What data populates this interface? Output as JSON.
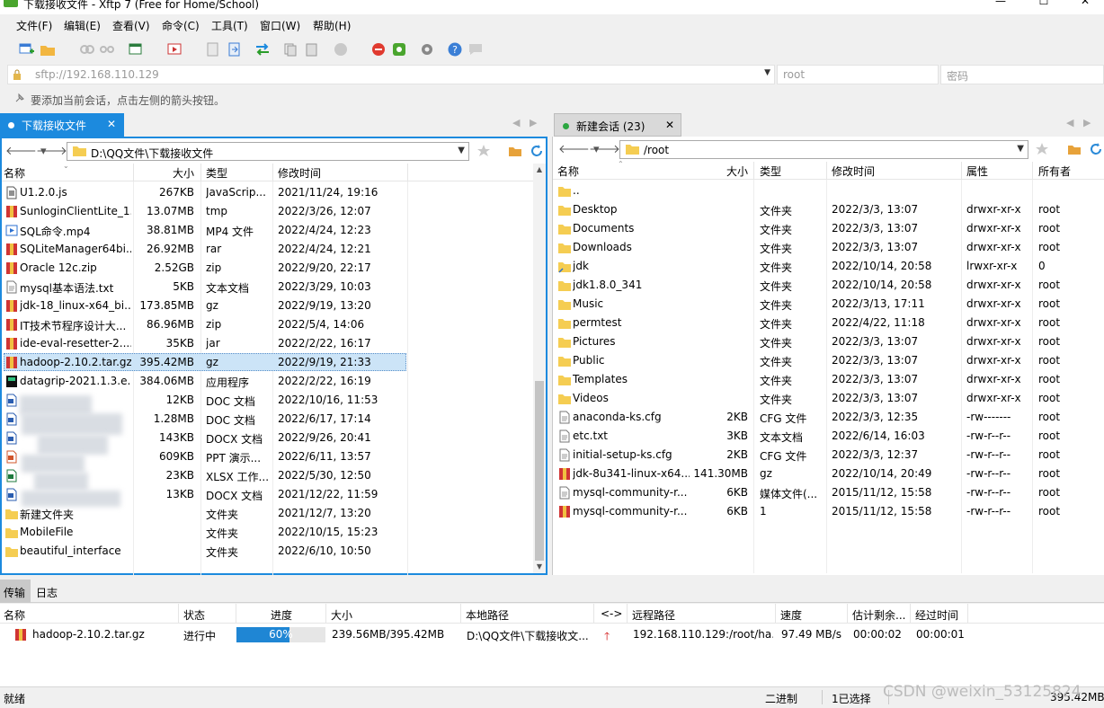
{
  "window": {
    "title": "下载接收文件 - Xftp 7 (Free for Home/School)",
    "minimize": "—",
    "maximize": "☐",
    "close": "✕"
  },
  "menu": [
    "文件(F)",
    "编辑(E)",
    "查看(V)",
    "命令(C)",
    "工具(T)",
    "窗口(W)",
    "帮助(H)"
  ],
  "address": {
    "host": "sftp://192.168.110.129",
    "user_placeholder": "root",
    "password_placeholder": "密码"
  },
  "hint": "要添加当前会话，点击左侧的箭头按钮。",
  "left": {
    "tab_label": "下载接收文件",
    "path": "D:\\QQ文件\\下载接收文件",
    "columns": [
      "名称",
      "大小",
      "类型",
      "修改时间"
    ],
    "files": [
      {
        "name": "U1.2.0.js",
        "size": "267KB",
        "type": "JavaScrip...",
        "modified": "2021/11/24, 19:16",
        "icon": "js-file-icon"
      },
      {
        "name": "SunloginClientLite_1...",
        "size": "13.07MB",
        "type": "tmp",
        "modified": "2022/3/26, 12:07",
        "icon": "archive-file-icon"
      },
      {
        "name": "SQL命令.mp4",
        "size": "38.81MB",
        "type": "MP4 文件",
        "modified": "2022/4/24, 12:23",
        "icon": "video-file-icon"
      },
      {
        "name": "SQLiteManager64bi...",
        "size": "26.92MB",
        "type": "rar",
        "modified": "2022/4/24, 12:21",
        "icon": "archive-file-icon"
      },
      {
        "name": "Oracle 12c.zip",
        "size": "2.52GB",
        "type": "zip",
        "modified": "2022/9/20, 22:17",
        "icon": "archive-file-icon"
      },
      {
        "name": "mysql基本语法.txt",
        "size": "5KB",
        "type": "文本文档",
        "modified": "2022/3/29, 10:03",
        "icon": "text-file-icon"
      },
      {
        "name": "jdk-18_linux-x64_bi...",
        "size": "173.85MB",
        "type": "gz",
        "modified": "2022/9/19, 13:20",
        "icon": "archive-file-icon"
      },
      {
        "name": "IT技术节程序设计大...",
        "size": "86.96MB",
        "type": "zip",
        "modified": "2022/5/4, 14:06",
        "icon": "archive-file-icon"
      },
      {
        "name": "ide-eval-resetter-2....",
        "size": "35KB",
        "type": "jar",
        "modified": "2022/2/22, 16:17",
        "icon": "archive-file-icon"
      },
      {
        "name": "hadoop-2.10.2.tar.gz",
        "size": "395.42MB",
        "type": "gz",
        "modified": "2022/9/19, 21:33",
        "icon": "archive-file-icon"
      },
      {
        "name": "datagrip-2021.1.3.e...",
        "size": "384.06MB",
        "type": "应用程序",
        "modified": "2022/2/22, 16:19",
        "icon": "app-file-icon"
      },
      {
        "name": "",
        "size": "12KB",
        "type": "DOC 文档",
        "modified": "2022/10/16, 11:53",
        "icon": "doc-file-icon"
      },
      {
        "name": "",
        "size": "1.28MB",
        "type": "DOC 文档",
        "modified": "2022/6/17, 17:14",
        "icon": "doc-file-icon"
      },
      {
        "name": "",
        "size": "143KB",
        "type": "DOCX 文档",
        "modified": "2022/9/26, 20:41",
        "icon": "doc-file-icon"
      },
      {
        "name": "",
        "size": "609KB",
        "type": "PPT 演示...",
        "modified": "2022/6/11, 13:57",
        "icon": "ppt-file-icon"
      },
      {
        "name": "",
        "size": "23KB",
        "type": "XLSX 工作...",
        "modified": "2022/5/30, 12:50",
        "icon": "xlsx-file-icon"
      },
      {
        "name": "",
        "size": "13KB",
        "type": "DOCX 文档",
        "modified": "2021/12/22, 11:59",
        "icon": "doc-file-icon"
      },
      {
        "name": "新建文件夹",
        "size": "",
        "type": "文件夹",
        "modified": "2021/12/7, 13:20",
        "icon": "folder-icon"
      },
      {
        "name": "MobileFile",
        "size": "",
        "type": "文件夹",
        "modified": "2022/10/15, 15:23",
        "icon": "folder-icon"
      },
      {
        "name": "beautiful_interface",
        "size": "",
        "type": "文件夹",
        "modified": "2022/6/10, 10:50",
        "icon": "folder-icon"
      }
    ]
  },
  "right": {
    "tab_label": "新建会话 (23)",
    "path": "/root",
    "columns": [
      "名称",
      "大小",
      "类型",
      "修改时间",
      "属性",
      "所有者"
    ],
    "files": [
      {
        "name": "..",
        "size": "",
        "type": "",
        "modified": "",
        "attr": "",
        "owner": "",
        "icon": "folder-icon"
      },
      {
        "name": "Desktop",
        "size": "",
        "type": "文件夹",
        "modified": "2022/3/3, 13:07",
        "attr": "drwxr-xr-x",
        "owner": "root",
        "icon": "folder-icon"
      },
      {
        "name": "Documents",
        "size": "",
        "type": "文件夹",
        "modified": "2022/3/3, 13:07",
        "attr": "drwxr-xr-x",
        "owner": "root",
        "icon": "folder-icon"
      },
      {
        "name": "Downloads",
        "size": "",
        "type": "文件夹",
        "modified": "2022/3/3, 13:07",
        "attr": "drwxr-xr-x",
        "owner": "root",
        "icon": "folder-icon"
      },
      {
        "name": "jdk",
        "size": "",
        "type": "文件夹",
        "modified": "2022/10/14, 20:58",
        "attr": "lrwxr-xr-x",
        "owner": "0",
        "icon": "folder-link-icon"
      },
      {
        "name": "jdk1.8.0_341",
        "size": "",
        "type": "文件夹",
        "modified": "2022/10/14, 20:58",
        "attr": "drwxr-xr-x",
        "owner": "root",
        "icon": "folder-icon"
      },
      {
        "name": "Music",
        "size": "",
        "type": "文件夹",
        "modified": "2022/3/13, 17:11",
        "attr": "drwxr-xr-x",
        "owner": "root",
        "icon": "folder-icon"
      },
      {
        "name": "permtest",
        "size": "",
        "type": "文件夹",
        "modified": "2022/4/22, 11:18",
        "attr": "drwxr-xr-x",
        "owner": "root",
        "icon": "folder-icon"
      },
      {
        "name": "Pictures",
        "size": "",
        "type": "文件夹",
        "modified": "2022/3/3, 13:07",
        "attr": "drwxr-xr-x",
        "owner": "root",
        "icon": "folder-icon"
      },
      {
        "name": "Public",
        "size": "",
        "type": "文件夹",
        "modified": "2022/3/3, 13:07",
        "attr": "drwxr-xr-x",
        "owner": "root",
        "icon": "folder-icon"
      },
      {
        "name": "Templates",
        "size": "",
        "type": "文件夹",
        "modified": "2022/3/3, 13:07",
        "attr": "drwxr-xr-x",
        "owner": "root",
        "icon": "folder-icon"
      },
      {
        "name": "Videos",
        "size": "",
        "type": "文件夹",
        "modified": "2022/3/3, 13:07",
        "attr": "drwxr-xr-x",
        "owner": "root",
        "icon": "folder-icon"
      },
      {
        "name": "anaconda-ks.cfg",
        "size": "2KB",
        "type": "CFG 文件",
        "modified": "2022/3/3, 12:35",
        "attr": "-rw-------",
        "owner": "root",
        "icon": "text-file-icon"
      },
      {
        "name": "etc.txt",
        "size": "3KB",
        "type": "文本文档",
        "modified": "2022/6/14, 16:03",
        "attr": "-rw-r--r--",
        "owner": "root",
        "icon": "text-file-icon"
      },
      {
        "name": "initial-setup-ks.cfg",
        "size": "2KB",
        "type": "CFG 文件",
        "modified": "2022/3/3, 12:37",
        "attr": "-rw-r--r--",
        "owner": "root",
        "icon": "text-file-icon"
      },
      {
        "name": "jdk-8u341-linux-x64...",
        "size": "141.30MB",
        "type": "gz",
        "modified": "2022/10/14, 20:49",
        "attr": "-rw-r--r--",
        "owner": "root",
        "icon": "archive-file-icon"
      },
      {
        "name": "mysql-community-r...",
        "size": "6KB",
        "type": "媒体文件(...",
        "modified": "2015/11/12, 15:58",
        "attr": "-rw-r--r--",
        "owner": "root",
        "icon": "text-file-icon"
      },
      {
        "name": "mysql-community-r...",
        "size": "6KB",
        "type": "1",
        "modified": "2015/11/12, 15:58",
        "attr": "-rw-r--r--",
        "owner": "root",
        "icon": "archive-file-icon"
      }
    ]
  },
  "log_tabs": [
    "传输",
    "日志"
  ],
  "transfer": {
    "columns": [
      "名称",
      "状态",
      "进度",
      "大小",
      "本地路径",
      "<->",
      "远程路径",
      "速度",
      "估计剩余...",
      "经过时间"
    ],
    "rows": [
      {
        "name": "hadoop-2.10.2.tar.gz",
        "status": "进行中",
        "progress": 60,
        "progress_label": "60%",
        "size": "239.56MB/395.42MB",
        "local": "D:\\QQ文件\\下载接收文...",
        "remote": "192.168.110.129:/root/ha...",
        "speed": "97.49 MB/s",
        "remaining": "00:00:02",
        "elapsed": "00:00:01"
      }
    ]
  },
  "status": {
    "left": "就绪",
    "mode": "二进制",
    "selection": "1已选择",
    "size": "395.42MB"
  },
  "watermark": "CSDN @weixin_53125824",
  "colors": {
    "accent": "#1c8ade",
    "selection": "#cce4f7",
    "folder": "#f5cd52",
    "archive": "#d03434",
    "session_dot": "#2ba640",
    "upload_arrow": "#d11010"
  }
}
